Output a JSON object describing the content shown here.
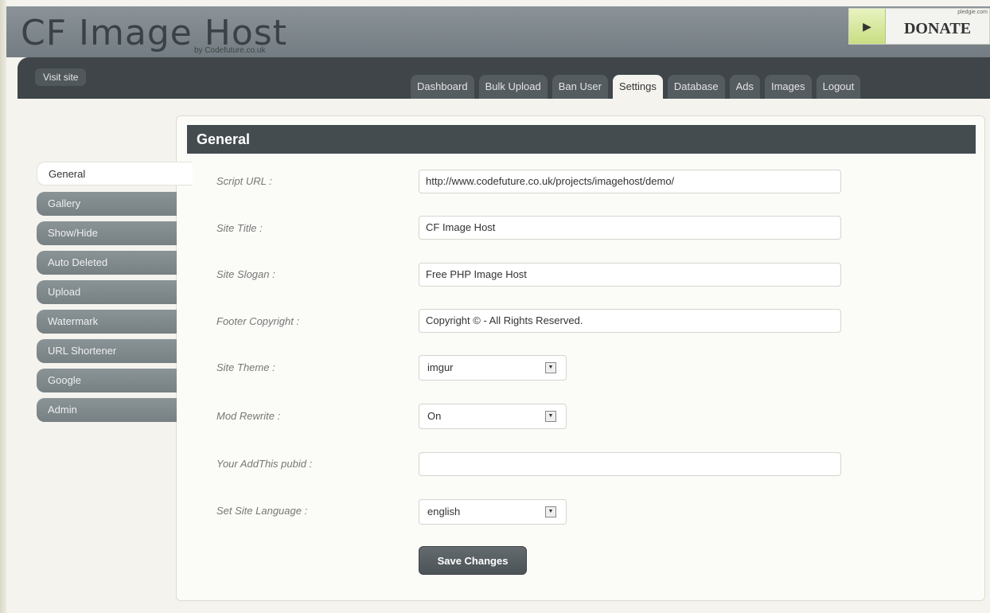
{
  "header": {
    "title": "CF Image Host",
    "subtitle": "by Codefuture.co.uk",
    "donate_label": "DONATE",
    "donate_tiny": "pledgie.com"
  },
  "navbar": {
    "visit_site": "Visit site",
    "tabs": [
      {
        "label": "Dashboard",
        "active": false
      },
      {
        "label": "Bulk Upload",
        "active": false
      },
      {
        "label": "Ban User",
        "active": false
      },
      {
        "label": "Settings",
        "active": true
      },
      {
        "label": "Database",
        "active": false
      },
      {
        "label": "Ads",
        "active": false
      },
      {
        "label": "Images",
        "active": false
      },
      {
        "label": "Logout",
        "active": false
      }
    ]
  },
  "sidemenu": {
    "items": [
      {
        "label": "General",
        "active": true
      },
      {
        "label": "Gallery",
        "active": false
      },
      {
        "label": "Show/Hide",
        "active": false
      },
      {
        "label": "Auto Deleted",
        "active": false
      },
      {
        "label": "Upload",
        "active": false
      },
      {
        "label": "Watermark",
        "active": false
      },
      {
        "label": "URL Shortener",
        "active": false
      },
      {
        "label": "Google",
        "active": false
      },
      {
        "label": "Admin",
        "active": false
      }
    ]
  },
  "panel": {
    "heading": "General",
    "fields": {
      "script_url": {
        "label": "Script URL :",
        "value": "http://www.codefuture.co.uk/projects/imagehost/demo/"
      },
      "site_title": {
        "label": "Site Title :",
        "value": "CF Image Host"
      },
      "site_slogan": {
        "label": "Site Slogan :",
        "value": "Free PHP Image Host"
      },
      "footer_copyright": {
        "label": "Footer Copyright :",
        "value": "Copyright © - All Rights Reserved."
      },
      "site_theme": {
        "label": "Site Theme :",
        "value": "imgur"
      },
      "mod_rewrite": {
        "label": "Mod Rewrite :",
        "value": "On"
      },
      "addthis_pubid": {
        "label": "Your AddThis pubid :",
        "value": ""
      },
      "site_language": {
        "label": "Set Site Language :",
        "value": "english"
      }
    },
    "save_label": "Save Changes"
  }
}
